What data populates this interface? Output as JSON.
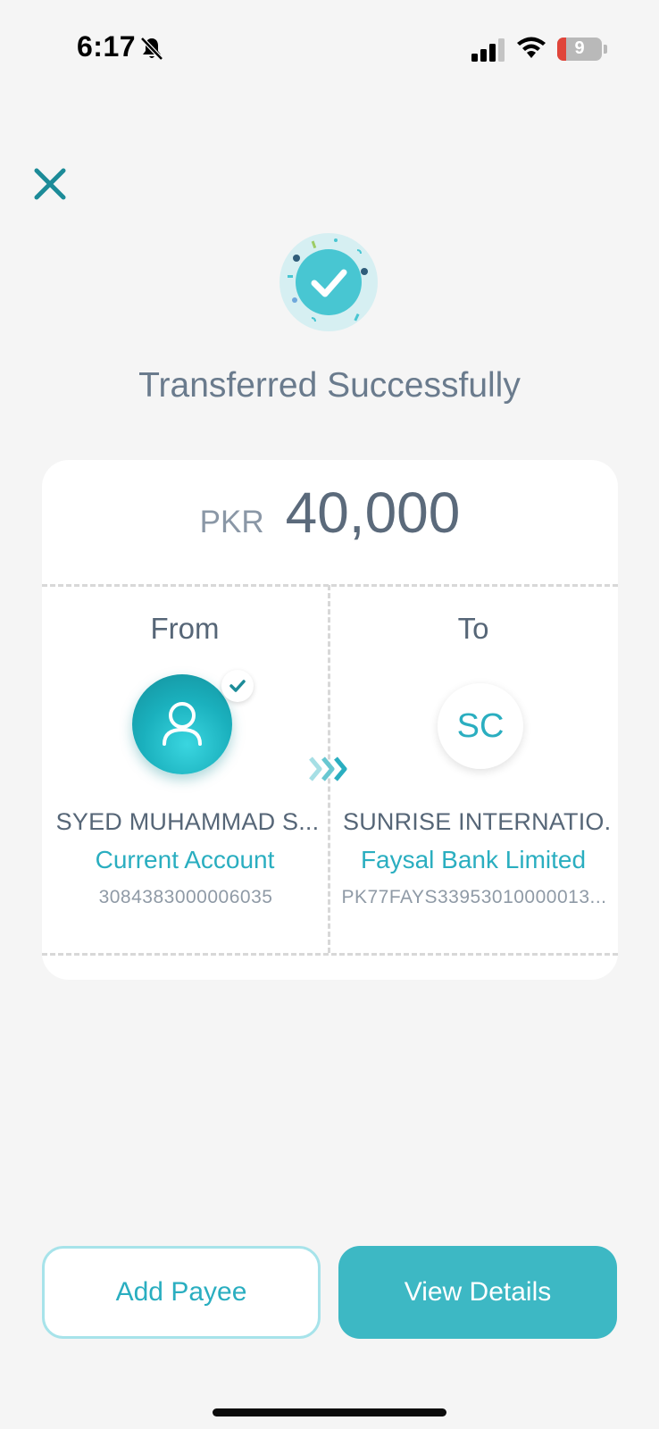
{
  "status_bar": {
    "time": "6:17",
    "battery_level": "9",
    "battery_fraction": 0.09,
    "icons": [
      "bell-muted-icon",
      "cellular-signal-icon",
      "wifi-icon",
      "battery-icon"
    ]
  },
  "header": {
    "close_icon": "close-icon"
  },
  "result": {
    "icon": "success-check-icon",
    "title": "Transferred Successfully"
  },
  "transfer": {
    "currency": "PKR",
    "amount": "40,000",
    "from": {
      "heading": "From",
      "name": "SYED MUHAMMAD S...",
      "account_type": "Current Account",
      "account_number": "3084383000006035"
    },
    "to": {
      "heading": "To",
      "initials": "SC",
      "name": "SUNRISE INTERNATIO...",
      "bank": "Faysal Bank Limited",
      "iban": "PK77FAYS33953010000013..."
    }
  },
  "actions": {
    "add_payee": "Add Payee",
    "view_details": "View Details"
  },
  "colors": {
    "accent": "#2aaec0",
    "primary_button": "#3db8c4",
    "text_muted": "#6a7b8d",
    "background": "#f5f5f5"
  }
}
